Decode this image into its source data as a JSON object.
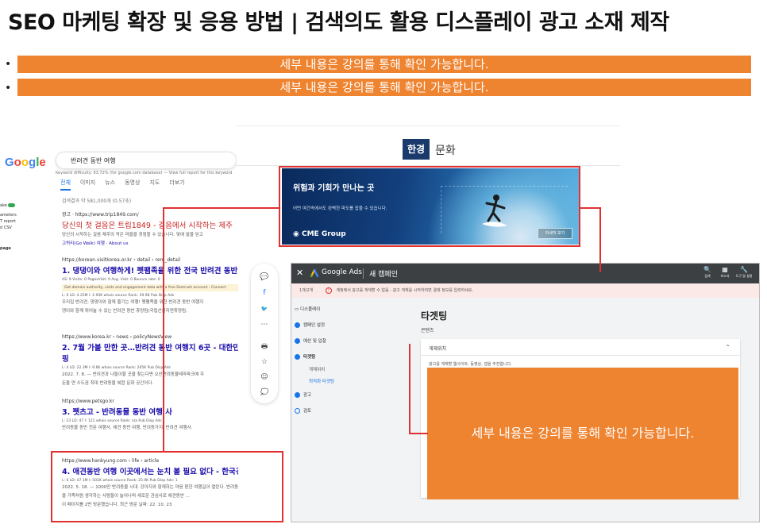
{
  "slide": {
    "title": "SEO 마케팅 확장 및 응용 방법 | 검색의도 활용 디스플레이 광고 소재 제작",
    "bullet_mark": "•",
    "bars": [
      "세부 내용은 강의를 통해 확인 가능합니다.",
      "세부 내용은 강의를 통해 확인 가능합니다."
    ],
    "overlay_text": "세부 내용은 강의를 통해 확인 가능합니다.",
    "accent_color": "#ee8330",
    "callout_color": "#e03030"
  },
  "google": {
    "logo": [
      "G",
      "o",
      "o",
      "g",
      "l",
      "e"
    ],
    "query": "반려견 동반 여행",
    "keyword_difficulty": "Keyword difficulty: 93.72% (for google.com database) — View full report for this keyword",
    "tabs": [
      "전체",
      "이미지",
      "뉴스",
      "동영상",
      "지도",
      "더보기"
    ],
    "result_count": "검색결과 약 581,000개 (0.57초)",
    "side_labels": [
      "ake",
      "ameters",
      "T report",
      "d CSV",
      "page"
    ],
    "results": [
      {
        "url": "광고 · https://www.trip1849.com/",
        "title": "당신의 첫 걸음은 트립1849 - 걸음에서 시작하는 제주",
        "snippet": "당신의 시작하는 걸음 제주의 작은 마을을 경험할 수 있습니다. 맞에 발을 딛고",
        "link": "고퀴리(Go Walk) 여행 · About us"
      },
      {
        "url": "https://korean.visitkorea.or.kr › detail › rem_detail",
        "title": "1. 댕댕이와 여행하게! 펫팸족을 위한 전국 반려견 동반",
        "metrics": "AS: 9   Visits: 0   PagesVisit: 0   Avg. Visit: 0   Bounce rate: 0",
        "highlight": "Get domain authority, visits and engagement data with a free Semrush account - Connect",
        "metrics2": "L: 0   LD: 4.25M   I: 2.93K   whois   source   Rank: 39.9K   Pub Disp Ads",
        "snippet": "우리집 반려견, 댕댕이와 함께 즐기는 여행! 펫팸족을 위한 반려견 동반 여행지",
        "snippet2": "댕이와 함께 뛰어놀 수 있는 반려견 동반 휴양림(국립산음자연휴양림,"
      },
      {
        "url": "https://www.korea.kr › news › policyNewsView",
        "title": "2. 7월 가볼 만한 곳…반려견 동반 여행지 6곳 - 대한민",
        "title2": "핑",
        "metrics": "L: 4   LD: 22.3M   I: 9.6K   whois   source   Rank: 205K   Pub Disp Ads",
        "snippet": "2022. 7. 8. — 반려견과 나들이할 곳을 찾는다면 오산반려동물테마파크에 주",
        "snippet2": "돈을 연 수도권 최대 반려동물 복합 문화 공간이다."
      },
      {
        "url": "https://www.petsgo.kr",
        "title": "3. 펫츠고 - 반려동물 동반 여행 사",
        "metrics": "L: 23   LD: 47   I: 121   whois   source   Rank: n/a   Pub Disp Ads",
        "snippet": "반려동물 동반 전문 여행사, 애견 동반 여행, 반려동가지, 반려견 여행사."
      },
      {
        "url": "https://www.hankyung.com › life › article",
        "title": "4. 애견동반 여행 이곳에서는 눈치 볼 필요 없다 - 한국경제",
        "metrics": "L: 6   LD: 47.1M   I: 501K   whois   source   Rank: 25.9K   Pub Disp Ads: 1",
        "snippet": "2022. 5. 18. — 1000만 반려동물 시대. 강아지와 함께하는 마음 편한 여행길이 열린다. 반려동물",
        "snippet2": "을 가족처럼 생각하는 사람들이 늘어나며 새로운 관심사로 애견동반 ...",
        "snippet3": "이 페이지를 2번 방문했습니다. 최근 방문 날짜: 22. 10. 23"
      }
    ]
  },
  "article": {
    "logo": "한경",
    "section": "문화",
    "share_icons": [
      "💬",
      "f",
      "🐦",
      "⋯",
      "🖶",
      "☆",
      "☺",
      "💭"
    ]
  },
  "ad_banner": {
    "headline": "위험과 기회가 만나는 곳",
    "subtext": "어떤 여건속에서도 완벽한 파도를 잡을 수 있습니다.",
    "brand": "CME Group",
    "cta": "자세히 보기",
    "sky_color": "#13407e"
  },
  "ads": {
    "close": "✕",
    "product": "Google Ads",
    "campaign": "새 캠페인",
    "tools": [
      {
        "icon": "🔍",
        "label": "검색"
      },
      {
        "icon": "▦",
        "label": "보고서"
      },
      {
        "icon": "🔧",
        "label": "도구 및 설정"
      }
    ],
    "warning_steps": "1개/2개",
    "warning": "계정에서 광고를 게재할 수 없음 - 광고 게재를 시작하려면 결제 정보를 입력하세요.",
    "nav": [
      {
        "label": "디스플레이",
        "kind": "header"
      },
      {
        "label": "캠페인 설정",
        "kind": "done"
      },
      {
        "label": "예산 및 입찰",
        "kind": "done"
      },
      {
        "label": "타겟팅",
        "kind": "current"
      },
      {
        "label": "게재위치",
        "kind": "sub"
      },
      {
        "label": "최적화 타겟팅",
        "kind": "sub-active"
      },
      {
        "label": "광고",
        "kind": "done"
      },
      {
        "label": "검토",
        "kind": "todo"
      }
    ],
    "heading": "타겟팅",
    "subheading": "콘텐츠",
    "card_title": "게재위치",
    "card_note": "광고를 게재할 웹사이트, 동영상, 앱을 추천합니다."
  }
}
